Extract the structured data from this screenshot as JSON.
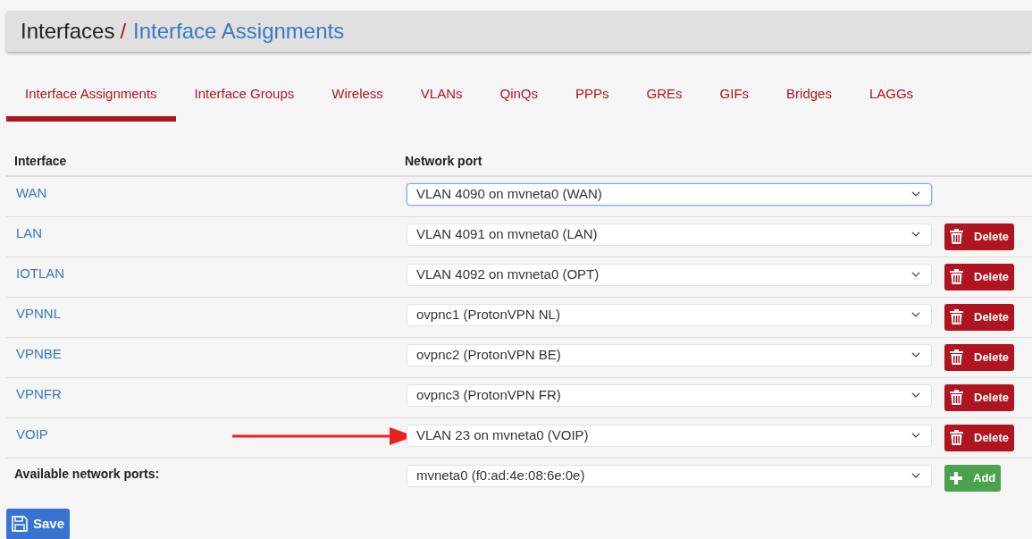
{
  "breadcrumb": {
    "parent": "Interfaces",
    "separator": "/",
    "current": "Interface Assignments"
  },
  "tabs": [
    {
      "label": "Interface Assignments",
      "selected": true
    },
    {
      "label": "Interface Groups",
      "selected": false
    },
    {
      "label": "Wireless",
      "selected": false
    },
    {
      "label": "VLANs",
      "selected": false
    },
    {
      "label": "QinQs",
      "selected": false
    },
    {
      "label": "PPPs",
      "selected": false
    },
    {
      "label": "GREs",
      "selected": false
    },
    {
      "label": "GIFs",
      "selected": false
    },
    {
      "label": "Bridges",
      "selected": false
    },
    {
      "label": "LAGGs",
      "selected": false
    }
  ],
  "table": {
    "columns": [
      "Interface",
      "Network port"
    ],
    "rows": [
      {
        "interface": "WAN",
        "port": "VLAN 4090 on mvneta0 (WAN)",
        "focused": true,
        "arrow": false
      },
      {
        "interface": "LAN",
        "port": "VLAN 4091 on mvneta0 (LAN)",
        "focused": false,
        "action": "Delete",
        "arrow": false
      },
      {
        "interface": "IOTLAN",
        "port": "VLAN 4092 on mvneta0 (OPT)",
        "focused": false,
        "action": "Delete",
        "arrow": false
      },
      {
        "interface": "VPNNL",
        "port": "ovpnc1 (ProtonVPN NL)",
        "focused": false,
        "action": "Delete",
        "arrow": false
      },
      {
        "interface": "VPNBE",
        "port": "ovpnc2 (ProtonVPN BE)",
        "focused": false,
        "action": "Delete",
        "arrow": false
      },
      {
        "interface": "VPNFR",
        "port": "ovpnc3 (ProtonVPN FR)",
        "focused": false,
        "action": "Delete",
        "arrow": false
      },
      {
        "interface": "VOIP",
        "port": "VLAN 23 on mvneta0 (VOIP)",
        "focused": false,
        "action": "Delete",
        "arrow": true
      }
    ],
    "available": {
      "label": "Available network ports:",
      "port": "mvneta0 (f0:ad:4e:08:6e:0e)",
      "action": "Add"
    }
  },
  "save_button": "Save"
}
